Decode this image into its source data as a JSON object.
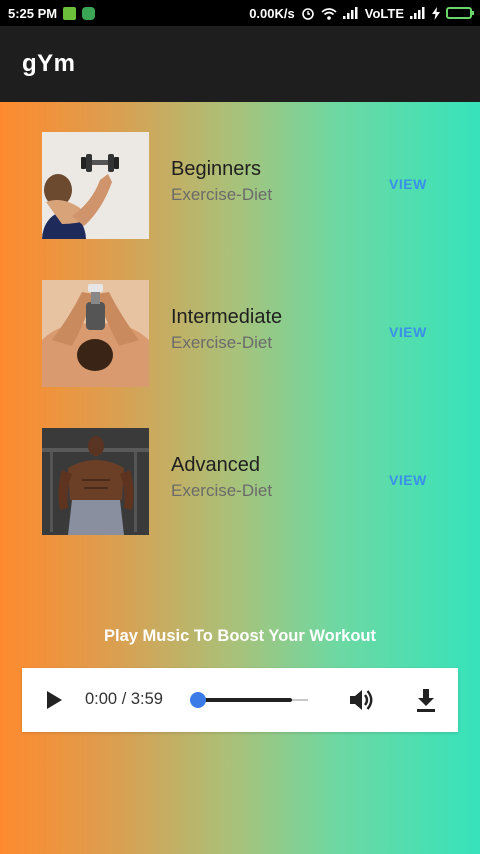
{
  "status_bar": {
    "time": "5:25 PM",
    "network_speed": "0.00K/s",
    "network_type": "VoLTE",
    "icons": [
      "gallery-icon",
      "whatsapp-icon",
      "alarm-icon",
      "wifi-icon",
      "signal-icon",
      "signal-icon",
      "charging-icon",
      "battery-icon"
    ]
  },
  "app_bar": {
    "title": "gYm"
  },
  "levels": [
    {
      "name": "Beginners",
      "subtitle": "Exercise-Diet",
      "action": "VIEW",
      "image": "dumbbell-curl-photo"
    },
    {
      "name": "Intermediate",
      "subtitle": "Exercise-Diet",
      "action": "VIEW",
      "image": "dumbbell-press-photo"
    },
    {
      "name": "Advanced",
      "subtitle": "Exercise-Diet",
      "action": "VIEW",
      "image": "bodybuilder-photo"
    }
  ],
  "music": {
    "label": "Play Music To Boost Your Workout",
    "time": "0:00 / 3:59",
    "progress_fraction": 0.0,
    "buffered_fraction": 0.85,
    "controls": [
      "play-icon",
      "volume-icon",
      "download-icon"
    ]
  },
  "colors": {
    "status_bar": "#000000",
    "app_bar": "#1e1e1e",
    "gradient_start": "#ff8a2e",
    "gradient_end": "#36e3bb",
    "view_link": "#3a8fe8",
    "seek_knob": "#3a7be8"
  }
}
